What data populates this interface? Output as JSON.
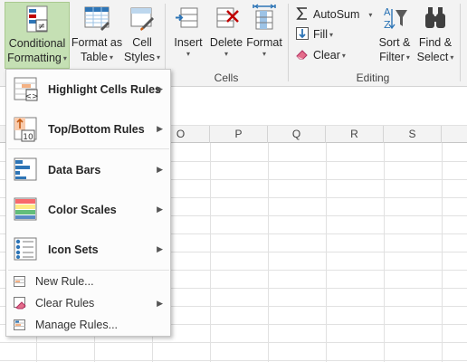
{
  "ribbon": {
    "styles": {
      "conditional_formatting": {
        "line1": "Conditional",
        "line2": "Formatting"
      },
      "format_as_table": {
        "line1": "Format as",
        "line2": "Table"
      },
      "cell_styles": {
        "line1": "Cell",
        "line2": "Styles"
      }
    },
    "cells": {
      "insert": "Insert",
      "delete": "Delete",
      "format": "Format",
      "group_label": "Cells"
    },
    "editing": {
      "autosum": "AutoSum",
      "fill": "Fill",
      "clear": "Clear",
      "sort_filter": {
        "line1": "Sort &",
        "line2": "Filter"
      },
      "find_select": {
        "line1": "Find &",
        "line2": "Select"
      },
      "group_label": "Editing"
    },
    "accent_active": "#c5e0b4"
  },
  "sheet": {
    "columns": [
      "O",
      "P",
      "Q",
      "R",
      "S"
    ]
  },
  "menu": {
    "items": [
      {
        "label": "Highlight Cells Rules",
        "icon": "highlight-cells-icon"
      },
      {
        "label": "Top/Bottom Rules",
        "icon": "top-bottom-icon"
      },
      {
        "label": "Data Bars",
        "icon": "data-bars-icon"
      },
      {
        "label": "Color Scales",
        "icon": "color-scales-icon"
      },
      {
        "label": "Icon Sets",
        "icon": "icon-sets-icon"
      }
    ],
    "new_rule": "New Rule...",
    "clear_rules": "Clear Rules",
    "manage_rules": "Manage Rules...",
    "top_bottom_badge": "10"
  }
}
